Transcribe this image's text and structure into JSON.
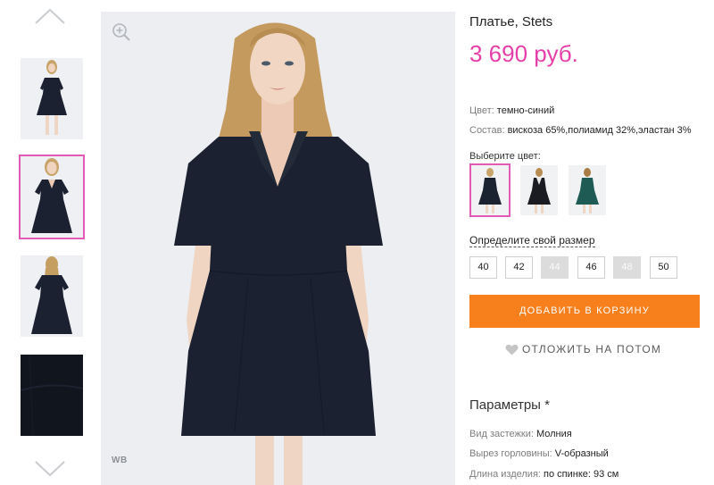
{
  "product": {
    "title": "Платье, Stets",
    "price": "3 690 руб."
  },
  "attributes": [
    {
      "label": "Цвет:",
      "value": "темно-синий"
    },
    {
      "label": "Состав:",
      "value": "вискоза 65%,полиамид 32%,эластан 3%"
    }
  ],
  "color_picker": {
    "label": "Выберите цвет:",
    "swatches": [
      {
        "color": "#1b2230",
        "selected": true
      },
      {
        "color": "#1a1c22",
        "selected": false
      },
      {
        "color": "#1f5b55",
        "selected": false
      }
    ]
  },
  "size_picker": {
    "label": "Определите свой размер",
    "sizes": [
      {
        "label": "40",
        "available": true
      },
      {
        "label": "42",
        "available": true
      },
      {
        "label": "44",
        "available": false
      },
      {
        "label": "46",
        "available": true
      },
      {
        "label": "48",
        "available": false
      },
      {
        "label": "50",
        "available": true
      }
    ]
  },
  "actions": {
    "add_to_cart": "ДОБАВИТЬ В КОРЗИНУ",
    "save_for_later": "ОТЛОЖИТЬ НА ПОТОМ"
  },
  "parameters": {
    "title": "Параметры *",
    "items": [
      {
        "label": "Вид застежки:",
        "value": "Молния"
      },
      {
        "label": "Вырез горловины:",
        "value": "V-образный"
      },
      {
        "label": "Длина изделия:",
        "value": "по спинке: 93 см"
      }
    ]
  },
  "gallery": {
    "selected_index": 1,
    "watermark": "WB"
  },
  "colors": {
    "accent_pink": "#e63fa8",
    "button_orange": "#f77f1c",
    "dress": "#1b2130"
  },
  "icons": [
    "chevron-up-icon",
    "chevron-down-icon",
    "zoom-in-icon",
    "heart-icon"
  ]
}
